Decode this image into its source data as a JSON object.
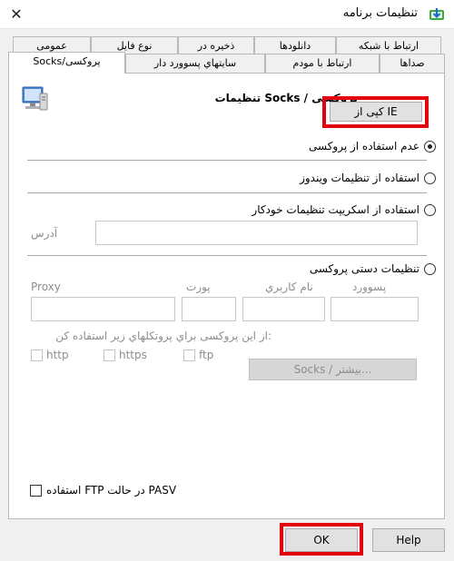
{
  "window": {
    "title": "تنظیمات برنامه",
    "close_glyph": "✕"
  },
  "tabs": {
    "row1": [
      "ارتباط با شبکه",
      "دانلودها",
      "ذخیره در",
      "نوع فایل",
      "عمومی"
    ],
    "row2": [
      "صداها",
      "ارتباط با مودم",
      "سايتهاي پسوورد دار",
      "Socks/پروکسی"
    ],
    "active": "Socks/پروکسی"
  },
  "panel": {
    "heading": "تنظیمات Socks / پروکسی",
    "copy_ie_button": "کپی از IE",
    "options": {
      "no_proxy": "عدم استفاده از پروکسی",
      "windows_settings": "استفاده از تنظیمات ویندوز",
      "auto_script": "استفاده از اسکریپت تنظیمات خودکار",
      "manual": "تنظیمات دستی پروکسی"
    },
    "selected_option": "no_proxy",
    "address_label": "آدرس",
    "columns": {
      "proxy": "Proxy",
      "port": "پورت",
      "username": "نام كاربري",
      "password": "پسوورد"
    },
    "use_for_protocols_label": "از این پروکسی براي پروتكلهاي زیر استفاده کن:",
    "protocols": [
      "http",
      "https",
      "ftp"
    ],
    "socks_more_button": "Socks / بیشتر...",
    "pasv_checkbox": "استفاده FTP در حالت PASV"
  },
  "footer": {
    "ok_button": "OK",
    "help_button": "Help"
  },
  "colors": {
    "highlight": "#e3000f"
  },
  "icons": {
    "app": "idm-app-icon",
    "panel": "proxy-computer-icon",
    "close": "close-icon"
  }
}
